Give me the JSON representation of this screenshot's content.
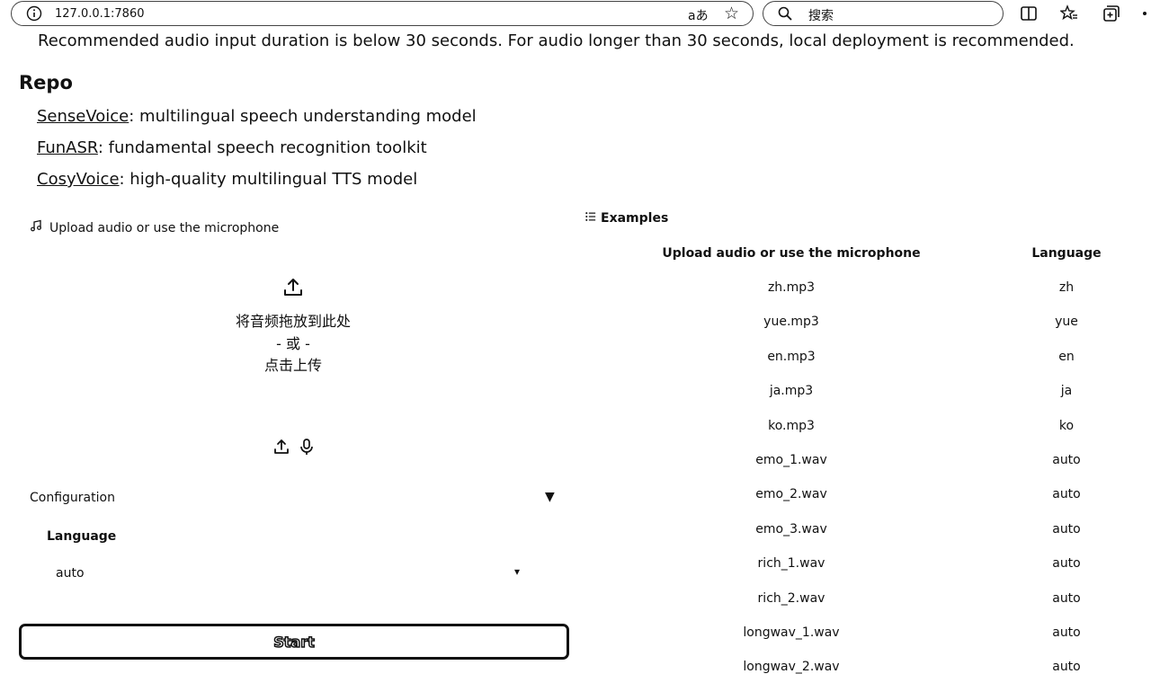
{
  "browser": {
    "url": "127.0.0.1:7860",
    "search_placeholder": "搜索",
    "translate_glyph": "aあ"
  },
  "page": {
    "notice": "Recommended audio input duration is below 30 seconds. For audio longer than 30 seconds, local deployment is recommended.",
    "repo_title": "Repo",
    "repos": [
      {
        "name": "SenseVoice",
        "desc": ": multilingual speech understanding model"
      },
      {
        "name": "FunASR",
        "desc": ": fundamental speech recognition toolkit"
      },
      {
        "name": "CosyVoice",
        "desc": ": high-quality multilingual TTS model"
      }
    ]
  },
  "audio_input": {
    "label": "Upload audio or use the microphone",
    "drop_line1": "将音频拖放到此处",
    "drop_or": "- 或 -",
    "drop_line2": "点击上传"
  },
  "config": {
    "title": "Configuration",
    "toggle_glyph": "▼",
    "language_label": "Language",
    "language_value": "auto",
    "caret_glyph": "▾"
  },
  "start_label": "Start",
  "examples": {
    "title": "Examples",
    "headers": [
      "Upload audio or use the microphone",
      "Language"
    ],
    "rows": [
      {
        "file": "zh.mp3",
        "lang": "zh"
      },
      {
        "file": "yue.mp3",
        "lang": "yue"
      },
      {
        "file": "en.mp3",
        "lang": "en"
      },
      {
        "file": "ja.mp3",
        "lang": "ja"
      },
      {
        "file": "ko.mp3",
        "lang": "ko"
      },
      {
        "file": "emo_1.wav",
        "lang": "auto"
      },
      {
        "file": "emo_2.wav",
        "lang": "auto"
      },
      {
        "file": "emo_3.wav",
        "lang": "auto"
      },
      {
        "file": "rich_1.wav",
        "lang": "auto"
      },
      {
        "file": "rich_2.wav",
        "lang": "auto"
      },
      {
        "file": "longwav_1.wav",
        "lang": "auto"
      },
      {
        "file": "longwav_2.wav",
        "lang": "auto"
      }
    ]
  },
  "icons": [
    "info-icon",
    "translate-icon",
    "favorite-star-icon",
    "search-icon",
    "split-screen-icon",
    "favorites-icon",
    "collections-icon",
    "music-note-icon",
    "upload-icon",
    "microphone-icon",
    "list-icon"
  ]
}
